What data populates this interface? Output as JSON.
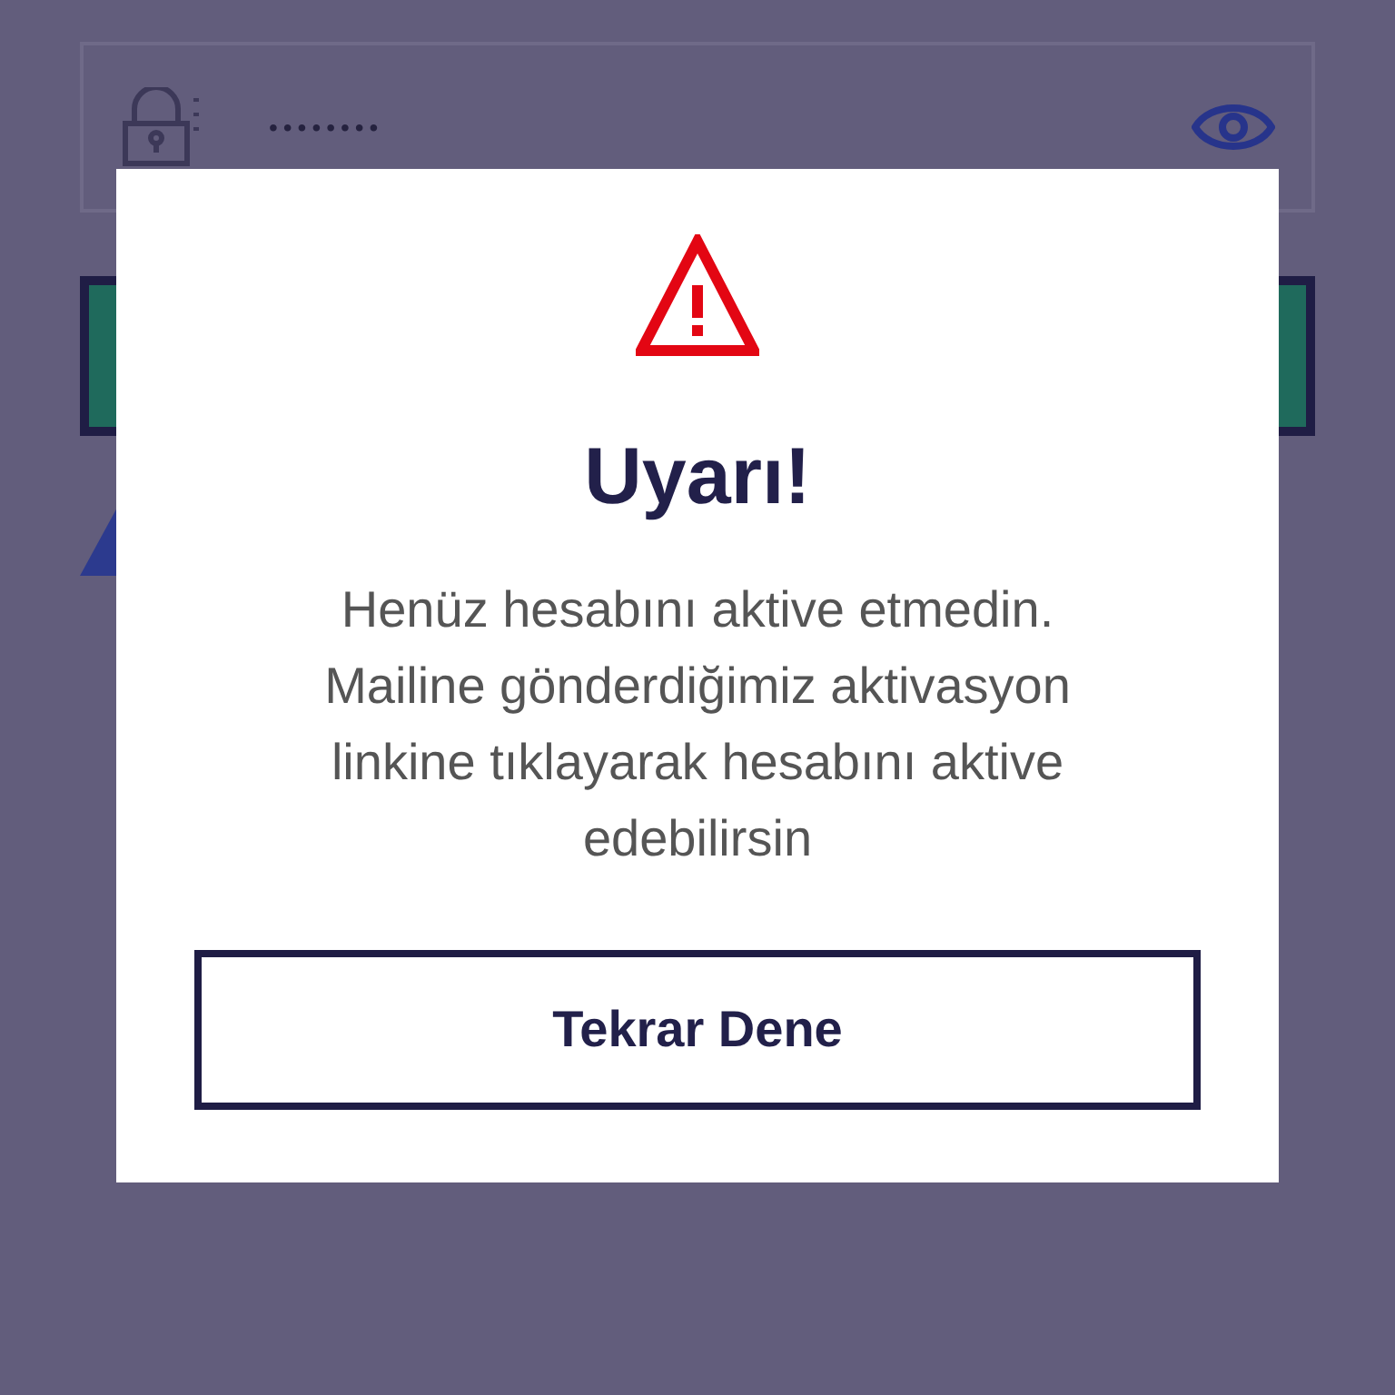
{
  "password_field": {
    "value": "••••••••"
  },
  "dialog": {
    "title": "Uyarı!",
    "message": "Henüz hesabını aktive etmedin. Mailine gönderdiğimiz aktivasyon linkine tıklayarak hesabını aktive edebilirsin",
    "button": "Tekrar Dene"
  }
}
